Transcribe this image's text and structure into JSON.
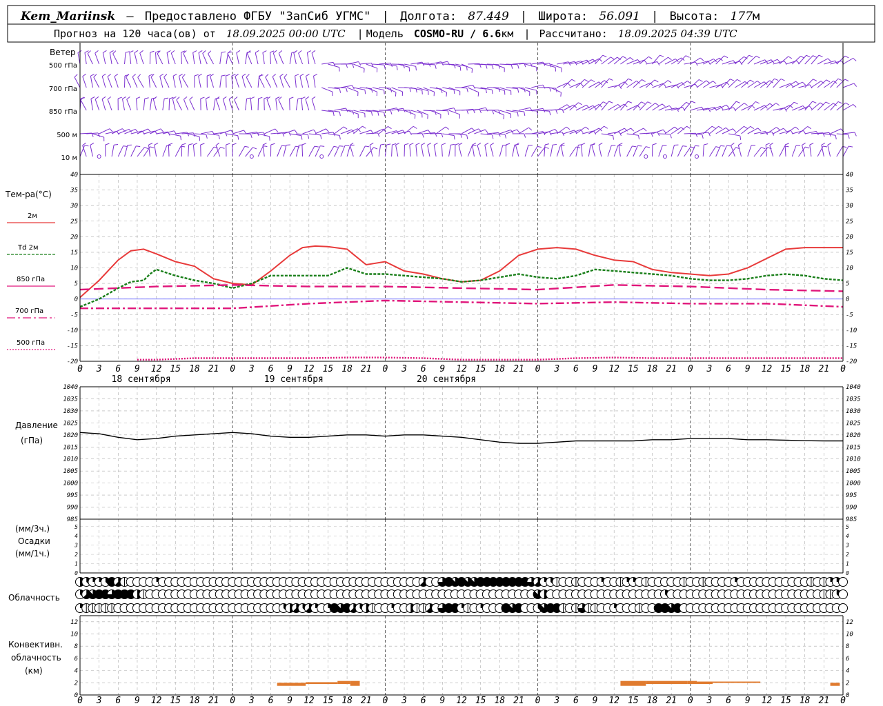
{
  "header": {
    "station": "Kem_Mariinsk",
    "dash": "–",
    "provider": "Предоставлено ФГБУ \"ЗапСиб УГМС\"",
    "lon_label": "Долгота:",
    "lon_value": "87.449",
    "lat_label": "Широта:",
    "lat_value": "56.091",
    "alt_label": "Высота:",
    "alt_value": "177",
    "alt_unit": "м",
    "forecast_label": "Прогноз на 120 часа(ов) от",
    "forecast_start": "18.09.2025 00:00 UTC",
    "model_label": "Модель",
    "model_name": "COSMO-RU / 6.6",
    "model_unit": "км",
    "calc_label": "Рассчитано:",
    "calc_time": "18.09.2025 04:39 UTC"
  },
  "wind_panel": {
    "title": "Ветер",
    "levels": [
      "500 гПа",
      "700 гПа",
      "850 гПа",
      "500 м",
      "10 м"
    ],
    "color": "#7b2fd0"
  },
  "temp_panel": {
    "title": "Тем-ра(°C)",
    "legend": [
      {
        "label": "2м",
        "color": "#e83a3a",
        "dash": "none"
      },
      {
        "label": "Td 2м",
        "color": "#1a7f1a",
        "dash": "4,2"
      },
      {
        "label": "850 гПа",
        "color": "#e0157a",
        "dash": "14,6"
      },
      {
        "label": "700 гПа",
        "color": "#e0157a",
        "dash": "12,4,3,4"
      },
      {
        "label": "500 гПа",
        "color": "#e0157a",
        "dash": "2,2"
      }
    ]
  },
  "pressure_panel": {
    "title": "Давление",
    "unit": "(гПа)"
  },
  "precip_panel": {
    "unit3": "(мм/3ч.)",
    "title": "Осадки",
    "unit1": "(мм/1ч.)"
  },
  "cloud_panel": {
    "title": "Облачность"
  },
  "conv_panel": {
    "title1": "Конвективн.",
    "title2": "облачность",
    "unit": "(км)"
  },
  "days": [
    "18 сентября",
    "19 сентября",
    "20 сентября"
  ],
  "hour_labels": [
    "0",
    "3",
    "6",
    "9",
    "12",
    "15",
    "18",
    "21"
  ],
  "chart_data": [
    {
      "type": "line",
      "title": "Тем-ра(°C)",
      "x_unit": "hours from 18.09.2025 00:00 UTC",
      "ylim": [
        -20,
        40
      ],
      "yticks": [
        -20,
        -15,
        -10,
        -5,
        0,
        5,
        10,
        15,
        20,
        25,
        30,
        35,
        40
      ],
      "grid": true,
      "series": [
        {
          "name": "2м",
          "x": [
            0,
            3,
            6,
            8,
            10,
            12,
            15,
            18,
            21,
            24,
            27,
            30,
            33,
            35,
            37,
            39,
            42,
            45,
            48,
            51,
            54,
            57,
            60,
            63,
            66,
            69,
            72,
            75,
            78,
            81,
            84,
            87,
            90,
            93,
            96,
            99,
            102,
            105,
            108,
            111,
            114,
            117,
            120
          ],
          "values": [
            0.5,
            6,
            12.5,
            15.5,
            16,
            14.5,
            12,
            10.5,
            6.5,
            5,
            4.5,
            9,
            14,
            16.5,
            17,
            16.8,
            16,
            11,
            12,
            9,
            8,
            6.5,
            5.5,
            6,
            9,
            14,
            16,
            16.5,
            16,
            14,
            12.5,
            12,
            9.5,
            8.5,
            8,
            7.5,
            8,
            10,
            13,
            16,
            16.5,
            16.5,
            16.5
          ]
        },
        {
          "name": "Td 2м",
          "x": [
            0,
            3,
            6,
            8,
            10,
            11,
            12,
            15,
            18,
            21,
            24,
            27,
            30,
            33,
            36,
            39,
            42,
            45,
            48,
            51,
            54,
            57,
            60,
            63,
            66,
            69,
            72,
            75,
            78,
            81,
            84,
            87,
            90,
            93,
            96,
            99,
            102,
            105,
            108,
            111,
            114,
            117,
            120
          ],
          "values": [
            -2.5,
            0,
            3.5,
            5.5,
            6,
            8,
            9.5,
            7.5,
            6,
            5,
            3.5,
            5,
            7.5,
            7.5,
            7.5,
            7.5,
            10,
            8,
            8,
            7.5,
            7,
            6.5,
            5.5,
            6,
            7,
            8,
            7,
            6.5,
            7.5,
            9.5,
            9,
            8.5,
            8,
            7.5,
            6.5,
            6,
            6,
            6.5,
            7.5,
            8,
            7.5,
            6.5,
            6
          ]
        },
        {
          "name": "850 гПа",
          "x": [
            0,
            12,
            24,
            36,
            48,
            60,
            72,
            84,
            96,
            108,
            120
          ],
          "values": [
            3,
            4,
            4.5,
            4,
            4,
            3.5,
            3,
            4.5,
            4,
            3,
            2.5
          ]
        },
        {
          "name": "700 гПа",
          "x": [
            0,
            12,
            24,
            36,
            48,
            60,
            72,
            84,
            96,
            108,
            120
          ],
          "values": [
            -3,
            -3,
            -3,
            -1.5,
            -0.5,
            -1,
            -1.5,
            -1,
            -1.5,
            -1.5,
            -2.5
          ]
        },
        {
          "name": "500 гПа",
          "x": [
            9,
            12,
            18,
            24,
            30,
            36,
            42,
            48,
            54,
            60,
            66,
            72,
            78,
            84,
            90,
            96,
            102,
            108,
            114,
            120
          ],
          "values": [
            -19.5,
            -19.5,
            -19,
            -19,
            -19,
            -19,
            -18.8,
            -18.8,
            -19,
            -19.5,
            -19.5,
            -19.5,
            -19,
            -18.8,
            -19,
            -19,
            -19,
            -19,
            -19,
            -19
          ]
        }
      ]
    },
    {
      "type": "line",
      "title": "Давление",
      "ylabel": "(гПа)",
      "ylim": [
        985,
        1040
      ],
      "yticks": [
        985,
        990,
        995,
        1000,
        1005,
        1010,
        1015,
        1020,
        1025,
        1030,
        1035,
        1040
      ],
      "grid": true,
      "series": [
        {
          "name": "Давление",
          "x": [
            0,
            3,
            6,
            9,
            12,
            15,
            18,
            21,
            24,
            27,
            30,
            33,
            36,
            39,
            42,
            45,
            48,
            51,
            54,
            57,
            60,
            63,
            66,
            69,
            72,
            75,
            78,
            81,
            84,
            87,
            90,
            93,
            96,
            99,
            102,
            105,
            108,
            111,
            114,
            117,
            120
          ],
          "values": [
            1021,
            1020.5,
            1019,
            1018,
            1018.5,
            1019.5,
            1020,
            1020.5,
            1021,
            1020.5,
            1019.5,
            1019,
            1019,
            1019.5,
            1020,
            1020,
            1019.5,
            1020,
            1020,
            1019.5,
            1019,
            1018,
            1017,
            1016.5,
            1016.5,
            1017,
            1017.5,
            1017.5,
            1017.5,
            1017.5,
            1018,
            1018,
            1018.5,
            1018.5,
            1018.5,
            1018,
            1018,
            1017.8,
            1017.6,
            1017.5,
            1017.5
          ]
        }
      ]
    },
    {
      "type": "bar",
      "title": "Конвективн. облачность",
      "ylabel": "(км)",
      "ylim": [
        0,
        13
      ],
      "yticks": [
        0,
        2,
        4,
        6,
        8,
        10,
        12
      ],
      "color": "#e07b2f",
      "segments": [
        {
          "x0": 31,
          "x1": 35.5,
          "bottom": 1.5,
          "top": 2
        },
        {
          "x0": 35.5,
          "x1": 40.5,
          "bottom": 1.8,
          "top": 2.1
        },
        {
          "x0": 40.5,
          "x1": 42.5,
          "bottom": 1.8,
          "top": 2.3
        },
        {
          "x0": 42.5,
          "x1": 44,
          "bottom": 1.5,
          "top": 2.3
        },
        {
          "x0": 85,
          "x1": 89,
          "bottom": 1.5,
          "top": 2.3
        },
        {
          "x0": 89,
          "x1": 95.5,
          "bottom": 1.8,
          "top": 2.3
        },
        {
          "x0": 95.5,
          "x1": 97,
          "bottom": 1.8,
          "top": 2.3
        },
        {
          "x0": 97,
          "x1": 99.5,
          "bottom": 1.8,
          "top": 2.2
        },
        {
          "x0": 99.5,
          "x1": 107,
          "bottom": 2,
          "top": 2.2
        },
        {
          "x0": 118,
          "x1": 119.5,
          "bottom": 1.5,
          "top": 2
        }
      ]
    }
  ],
  "precip_ticks": [
    0,
    1,
    2,
    3,
    4,
    5
  ],
  "cloud_rows": {
    "row1": [
      4,
      3,
      2,
      2,
      3,
      8,
      5,
      1,
      0,
      0,
      0,
      0,
      2,
      0,
      0,
      0,
      0,
      0,
      0,
      0,
      0,
      0,
      0,
      0,
      0,
      0,
      0,
      0,
      0,
      0,
      0,
      0,
      0,
      0,
      0,
      0,
      0,
      0,
      0,
      0,
      0,
      0,
      0,
      0,
      0,
      0,
      0,
      0,
      0,
      0,
      0,
      0,
      0,
      0,
      5,
      0,
      0,
      6,
      8,
      7,
      8,
      7,
      7,
      8,
      8,
      8,
      8,
      8,
      8,
      8,
      8,
      6,
      5,
      2,
      3,
      1,
      0,
      0,
      1,
      0,
      0,
      0,
      2,
      0,
      0,
      1,
      2,
      2,
      0,
      1,
      0,
      0,
      0,
      0,
      0,
      1,
      0,
      0,
      1,
      0,
      0,
      0,
      0,
      2,
      0,
      0,
      0,
      0,
      0,
      0,
      0,
      0,
      0,
      0,
      0,
      1,
      0,
      1,
      2,
      2,
      0
    ],
    "row2": [
      3,
      5,
      7,
      8,
      8,
      6,
      8,
      8,
      8,
      4,
      1,
      0,
      0,
      0,
      0,
      0,
      0,
      0,
      0,
      0,
      0,
      0,
      0,
      0,
      0,
      0,
      0,
      0,
      0,
      0,
      0,
      0,
      0,
      0,
      0,
      0,
      0,
      0,
      0,
      0,
      0,
      0,
      0,
      0,
      0,
      0,
      0,
      0,
      0,
      0,
      0,
      0,
      0,
      0,
      0,
      0,
      0,
      0,
      0,
      0,
      0,
      0,
      0,
      0,
      0,
      0,
      0,
      0,
      0,
      0,
      0,
      0,
      7,
      4,
      0,
      0,
      0,
      0,
      0,
      0,
      0,
      0,
      0,
      0,
      0,
      0,
      0,
      0,
      0,
      0,
      0,
      0,
      3,
      0,
      0,
      0,
      0,
      0,
      0,
      0,
      0,
      0,
      0,
      0,
      0,
      0,
      0,
      0,
      0,
      0,
      0,
      0,
      0,
      0,
      0,
      0,
      0,
      1,
      1,
      3,
      0
    ],
    "row3": [
      2,
      1,
      1,
      1,
      1,
      1,
      0,
      0,
      0,
      0,
      0,
      0,
      0,
      0,
      0,
      0,
      0,
      0,
      0,
      0,
      0,
      0,
      0,
      0,
      0,
      0,
      0,
      0,
      0,
      0,
      0,
      0,
      3,
      4,
      5,
      3,
      5,
      2,
      0,
      2,
      8,
      7,
      8,
      5,
      3,
      4,
      1,
      0,
      0,
      2,
      0,
      0,
      4,
      1,
      1,
      5,
      0,
      6,
      8,
      8,
      2,
      1,
      0,
      2,
      0,
      0,
      0,
      8,
      7,
      8,
      0,
      0,
      3,
      7,
      8,
      8,
      1,
      0,
      1,
      6,
      1,
      1,
      0,
      0,
      2,
      0,
      0,
      0,
      1,
      0,
      0,
      8,
      8,
      7,
      8,
      0,
      0,
      0,
      0,
      0,
      0,
      0,
      0,
      0,
      0,
      0,
      0,
      0,
      0,
      0,
      0,
      0,
      0,
      0,
      0,
      0,
      0,
      0,
      0,
      0,
      0
    ]
  }
}
